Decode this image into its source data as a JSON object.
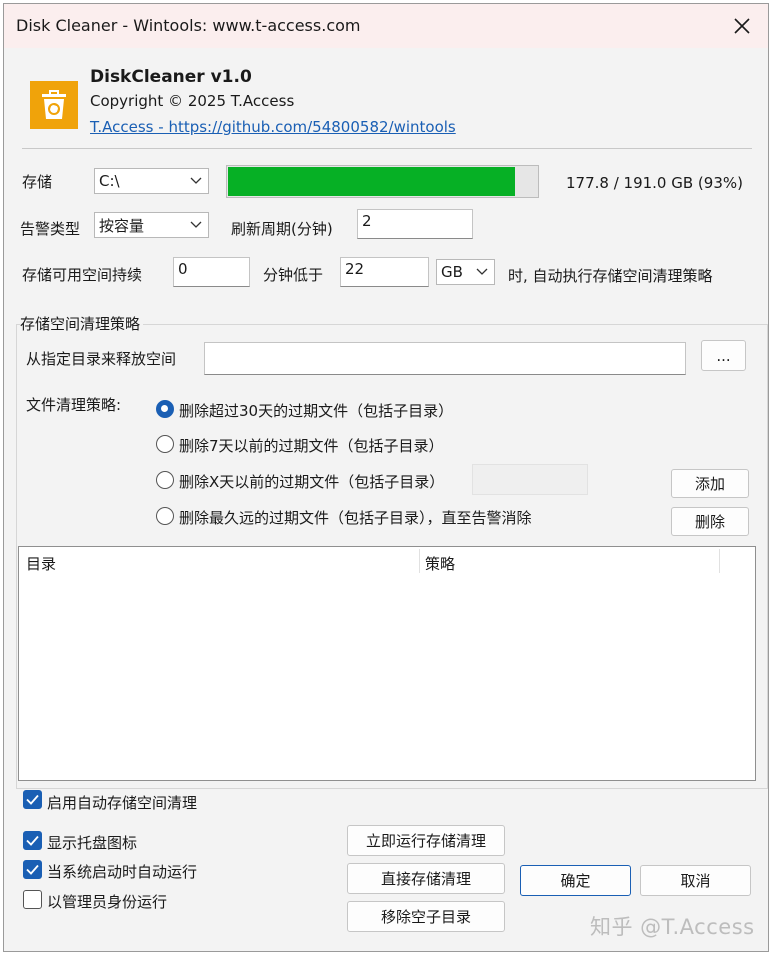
{
  "window": {
    "title": "Disk Cleaner - Wintools: www.t-access.com"
  },
  "about": {
    "app_name": "DiskCleaner v1.0",
    "copyright": "Copyright © 2025 T.Access",
    "link": "T.Access - https://github.com/54800582/wintools"
  },
  "storage": {
    "label": "存储",
    "drive": "C:\\",
    "usage_text": "177.8 / 191.0 GB (93%)",
    "used_fraction": 0.93,
    "bar_color": "#06b025"
  },
  "alert": {
    "type_label": "告警类型",
    "type_value": "按容量",
    "refresh_label": "刷新周期(分钟)",
    "refresh_value": "2"
  },
  "condition": {
    "prefix": "存储可用空间持续",
    "minutes_value": "0",
    "mid": "分钟低于",
    "threshold_value": "22",
    "unit": "GB",
    "suffix": "时, 自动执行存储空间清理策略"
  },
  "policy_group": {
    "title": "存储空间清理策略",
    "dir_label": "从指定目录来释放空间",
    "dir_value": "",
    "browse_label": "...",
    "strategy_label": "文件清理策略:",
    "options": [
      {
        "label": "删除超过30天的过期文件（包括子目录）",
        "checked": true
      },
      {
        "label": "删除7天以前的过期文件（包括子目录）",
        "checked": false
      },
      {
        "label": "删除X天以前的过期文件（包括子目录）",
        "checked": false
      },
      {
        "label": "删除最久远的过期文件（包括子目录），直至告警消除",
        "checked": false
      }
    ],
    "x_days_value": "",
    "add_label": "添加",
    "delete_label": "删除",
    "columns": [
      "目录",
      "策略"
    ],
    "rows": [],
    "auto_clean_label": "启用自动存储空间清理",
    "auto_clean_checked": true
  },
  "options": {
    "tray_label": "显示托盘图标",
    "tray_checked": true,
    "autostart_label": "当系统启动时自动运行",
    "autostart_checked": true,
    "admin_label": "以管理员身份运行",
    "admin_checked": false
  },
  "actions": {
    "run_now": "立即运行存储清理",
    "direct_clean": "直接存储清理",
    "remove_empty": "移除空子目录",
    "ok": "确定",
    "cancel": "取消"
  },
  "watermark": "知乎 @T.Access",
  "colors": {
    "accent": "#1a5fb4",
    "logo": "#f0a30a",
    "progress": "#06b025"
  }
}
